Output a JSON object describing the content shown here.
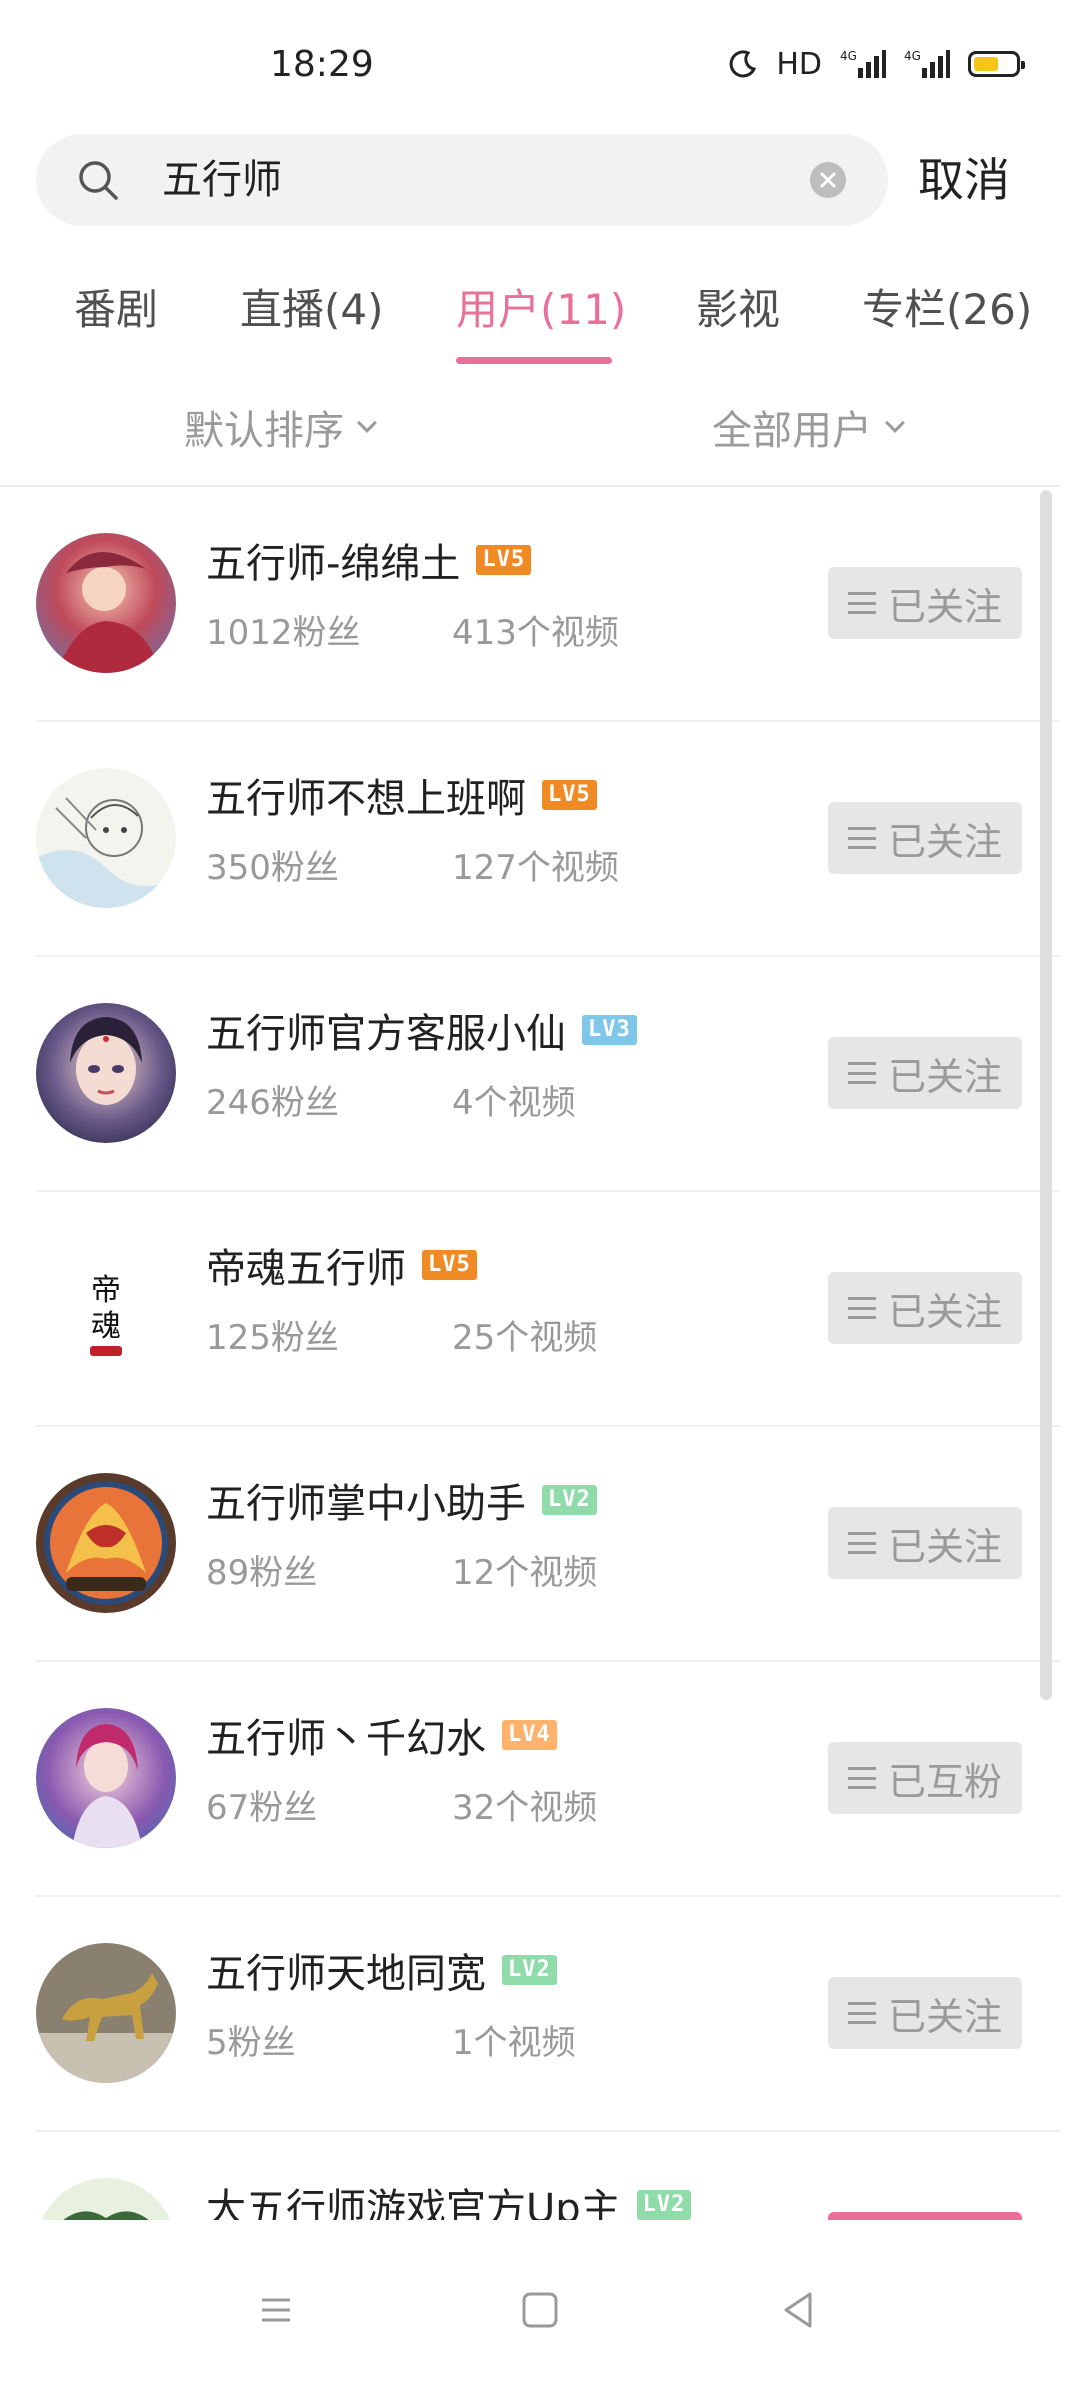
{
  "status_bar": {
    "time": "18:29",
    "hd_label": "HD",
    "network_1": "4G",
    "network_2": "4G"
  },
  "search": {
    "query": "五行师",
    "cancel_label": "取消"
  },
  "tabs": [
    {
      "label": "番剧"
    },
    {
      "label": "直播(4)"
    },
    {
      "label": "用户(11)",
      "active": true
    },
    {
      "label": "影视"
    },
    {
      "label": "专栏(26)"
    }
  ],
  "filters": {
    "sort_label": "默认排序",
    "scope_label": "全部用户"
  },
  "users": [
    {
      "name": "五行师-绵绵土",
      "level": "LV5",
      "level_color": "#f08a24",
      "fans": "1012粉丝",
      "videos": "413个视频",
      "button": "已关注"
    },
    {
      "name": "五行师不想上班啊",
      "level": "LV5",
      "level_color": "#f08a24",
      "fans": "350粉丝",
      "videos": "127个视频",
      "button": "已关注"
    },
    {
      "name": "五行师官方客服小仙",
      "level": "LV3",
      "level_color": "#7fc7e8",
      "fans": "246粉丝",
      "videos": "4个视频",
      "button": "已关注"
    },
    {
      "name": "帝魂五行师",
      "level": "LV5",
      "level_color": "#f08a24",
      "fans": "125粉丝",
      "videos": "25个视频",
      "button": "已关注",
      "avatar_text": "帝魂"
    },
    {
      "name": "五行师掌中小助手",
      "level": "LV2",
      "level_color": "#8fdcaa",
      "fans": "89粉丝",
      "videos": "12个视频",
      "button": "已关注"
    },
    {
      "name": "五行师丶千幻水",
      "level": "LV4",
      "level_color": "#ffb26b",
      "fans": "67粉丝",
      "videos": "32个视频",
      "button": "已互粉"
    },
    {
      "name": "五行师天地同宽",
      "level": "LV2",
      "level_color": "#8fdcaa",
      "fans": "5粉丝",
      "videos": "1个视频",
      "button": "已关注"
    },
    {
      "name": "大五行师游戏官方Up主",
      "level": "LV2",
      "level_color": "#8fdcaa"
    }
  ],
  "colors": {
    "accent": "#e97096",
    "follow_pink": "#ec6e96"
  },
  "icons": {
    "search": "search-icon",
    "clear": "clear-icon",
    "menu": "menu-icon",
    "nav_menu": "nav-menu-icon",
    "nav_home": "nav-home-icon",
    "nav_back": "nav-back-icon"
  }
}
